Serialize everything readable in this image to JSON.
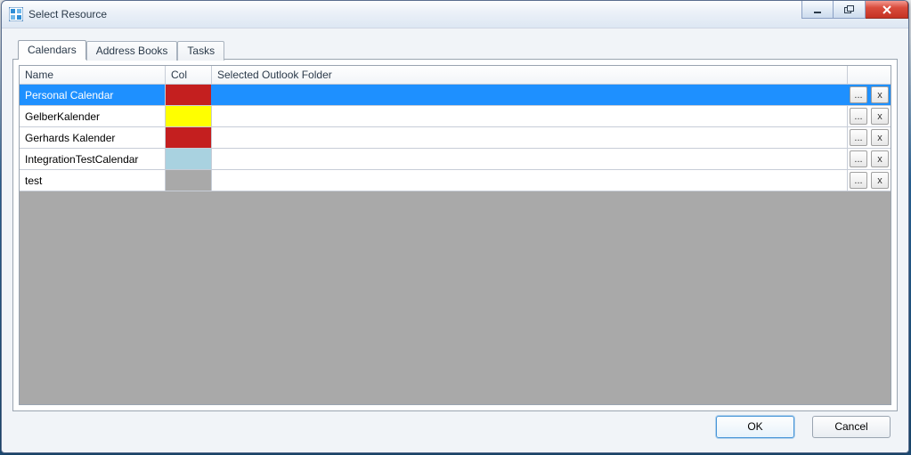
{
  "window": {
    "title": "Select Resource"
  },
  "tabs": [
    {
      "label": "Calendars",
      "active": true
    },
    {
      "label": "Address Books",
      "active": false
    },
    {
      "label": "Tasks",
      "active": false
    }
  ],
  "grid": {
    "headers": {
      "name": "Name",
      "col": "Col",
      "folder": "Selected Outlook Folder"
    },
    "rows": [
      {
        "name": "Personal Calendar",
        "color": "#c41f1f",
        "folder": "",
        "selected": true
      },
      {
        "name": "GelberKalender",
        "color": "#ffff00",
        "folder": "",
        "selected": false
      },
      {
        "name": "Gerhards Kalender",
        "color": "#c41f1f",
        "folder": "",
        "selected": false
      },
      {
        "name": "IntegrationTestCalendar",
        "color": "#a9d2e0",
        "folder": "",
        "selected": false
      },
      {
        "name": "test",
        "color": "#a9a9a9",
        "folder": "",
        "selected": false
      }
    ],
    "browse_label": "...",
    "delete_label": "x"
  },
  "buttons": {
    "ok": "OK",
    "cancel": "Cancel"
  }
}
